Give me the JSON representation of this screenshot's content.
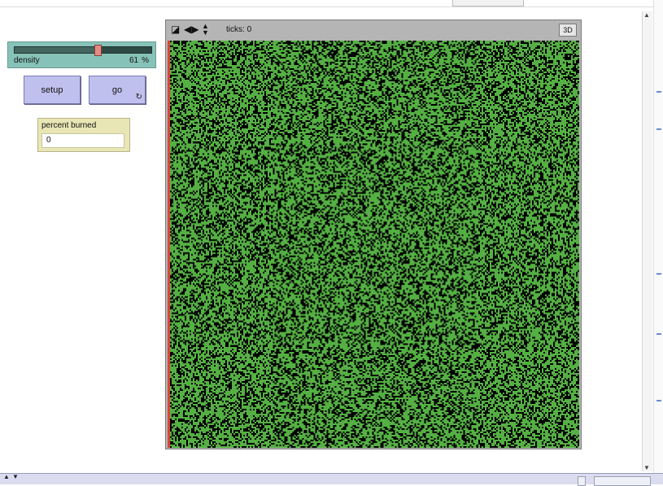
{
  "slider": {
    "name": "density",
    "value": "61",
    "unit": "%",
    "min": 0,
    "max": 100,
    "level": 61
  },
  "buttons": {
    "setup": "setup",
    "go": "go"
  },
  "icons": {
    "forever": "forever-icon",
    "size": "resize-icon",
    "h": "horizontal-arrows-icon",
    "v": "vertical-arrows-icon"
  },
  "monitor": {
    "label": "percent burned",
    "value": "0"
  },
  "view": {
    "ticks_label": "ticks:",
    "ticks_value": "0",
    "btn_3d": "3D",
    "colors": {
      "tree": "#55b043",
      "empty": "#000000",
      "fire": "#d9473a"
    },
    "density": 0.61
  }
}
